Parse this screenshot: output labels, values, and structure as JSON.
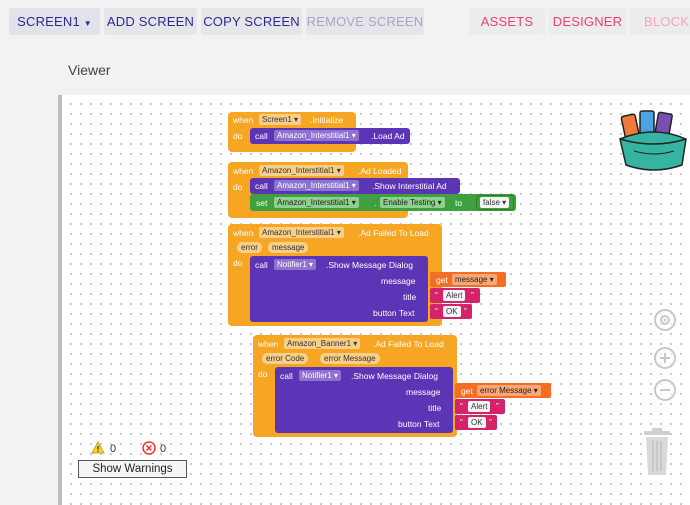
{
  "toolbar": {
    "screen_select": "SCREEN1",
    "add_screen": "ADD SCREEN",
    "copy_screen": "COPY SCREEN",
    "remove_screen": "REMOVE SCREEN",
    "assets": "ASSETS",
    "designer": "DESIGNER",
    "blocks": "BLOCKS"
  },
  "viewer": {
    "label": "Viewer"
  },
  "blocks": {
    "b1": {
      "when": "when",
      "component": "Screen1",
      "event": ".Initialize",
      "do": "do",
      "call": "call",
      "target": "Amazon_Interstitial1",
      "method": ".Load Ad"
    },
    "b2": {
      "when": "when",
      "component": "Amazon_Interstitial1",
      "event": ".Ad Loaded",
      "do": "do",
      "call": "call",
      "target": "Amazon_Interstitial1",
      "method": ".Show Interstitial Ad",
      "set": "set",
      "set_target": "Amazon_Interstitial1",
      "dot": ".",
      "property": "Enable Testing",
      "to": "to",
      "value": "false"
    },
    "b3": {
      "when": "when",
      "component": "Amazon_Interstitial1",
      "event": ".Ad Failed To Load",
      "param1": "error",
      "param2": "message",
      "do": "do",
      "call": "call",
      "target": "Notifier1",
      "method": ".Show Message Dialog",
      "arg1": "message",
      "arg2": "title",
      "arg3": "button Text",
      "get": "get",
      "get_var": "message",
      "title_val": "Alert",
      "button_val": "OK"
    },
    "b4": {
      "when": "when",
      "component": "Amazon_Banner1",
      "event": ".Ad Failed To Load",
      "param1": "error Code",
      "param2": "error Message",
      "do": "do",
      "call": "call",
      "target": "Notifier1",
      "method": ".Show Message Dialog",
      "arg1": "message",
      "arg2": "title",
      "arg3": "button Text",
      "get": "get",
      "get_var": "error Message",
      "title_val": "Alert",
      "button_val": "OK"
    }
  },
  "warnings": {
    "warning_count": "0",
    "error_count": "0",
    "show_warnings": "Show Warnings"
  },
  "icons": {
    "backpack": "backpack-icon",
    "target": "target-icon",
    "zoom_in": "zoom-in-icon",
    "zoom_out": "zoom-out-icon",
    "trash": "trash-icon",
    "warning": "warning-icon",
    "error": "error-icon"
  },
  "colors": {
    "event_block": "#f6a623",
    "procedure_block": "#5b35b5",
    "setter_block": "#3ea03e",
    "text_block": "#d3246a",
    "get_block": "#f36d24",
    "accent_pink": "#e8436a"
  }
}
